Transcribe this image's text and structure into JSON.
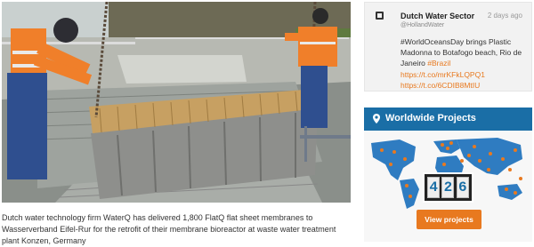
{
  "article": {
    "caption": "Dutch water technology firm WaterQ has delivered 1,800 FlatQ flat sheet membranes to Wasserverband Eifel-Rur for the retrofit of their membrane bioreactor at waste water treatment plant Konzen, Germany"
  },
  "tweet": {
    "author": "Dutch Water Sector",
    "handle": "@HollandWater",
    "time": "2 days ago",
    "text": "#WorldOceansDay brings Plastic Madonna to Botafogo beach, Rio de Janeiro",
    "hashtag": "#Brazil",
    "links": [
      "https://t.co/mrKFkLQPQ1",
      "https://t.co/6CDIB8MtIU"
    ]
  },
  "projects": {
    "title": "Worldwide Projects",
    "digits": [
      "4",
      "2",
      "6"
    ],
    "button_label": "View projects"
  },
  "colors": {
    "accent_orange": "#e8791f",
    "header_blue": "#1a6ea6"
  }
}
